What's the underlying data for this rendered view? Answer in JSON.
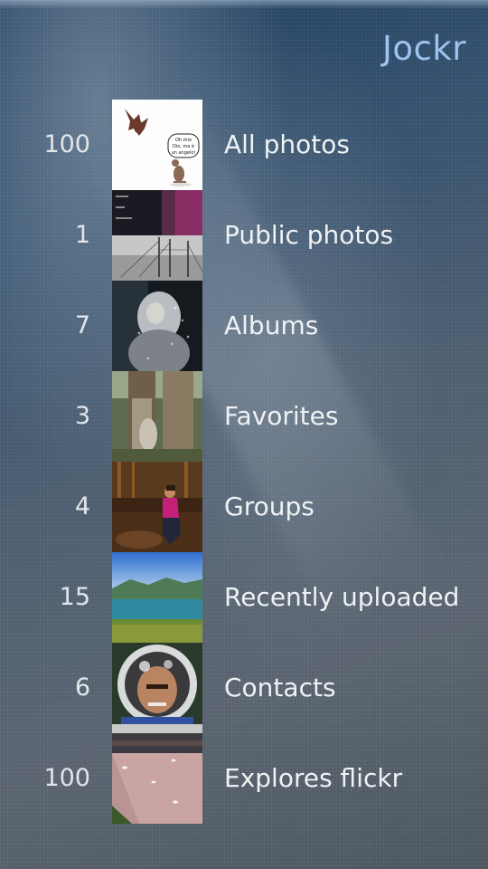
{
  "app": {
    "title": "Jockr"
  },
  "menu": {
    "items": [
      {
        "count": "100",
        "label": "All photos",
        "thumbnail": "bat-and-mouse-cartoon",
        "bubble_text": "Oh mio Dio, ma è un angelo!"
      },
      {
        "count": "1",
        "label": "Public photos",
        "thumbnail": "ship-masts-collage"
      },
      {
        "count": "7",
        "label": "Albums",
        "thumbnail": "dark-portrait"
      },
      {
        "count": "3",
        "label": "Favorites",
        "thumbnail": "tree-trunk"
      },
      {
        "count": "4",
        "label": "Groups",
        "thumbnail": "woman-on-bench"
      },
      {
        "count": "15",
        "label": "Recently uploaded",
        "thumbnail": "lake-landscape"
      },
      {
        "count": "6",
        "label": "Contacts",
        "thumbnail": "astronaut-helmet"
      },
      {
        "count": "100",
        "label": "Explores flickr",
        "thumbnail": "pond-with-birds"
      }
    ]
  },
  "colors": {
    "title": "#9cc4ee",
    "text": "#f0f2f4"
  }
}
